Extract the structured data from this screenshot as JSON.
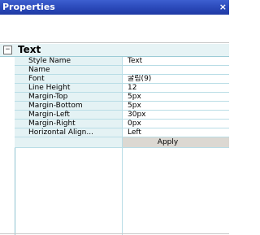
{
  "window": {
    "title": "Properties",
    "close_glyph": "×"
  },
  "section": {
    "label": "Text",
    "toggle": "−"
  },
  "properties": [
    {
      "name": "Style Name",
      "value": "Text"
    },
    {
      "name": "Name",
      "value": ""
    },
    {
      "name": "Font",
      "value": "굴림(9)"
    },
    {
      "name": "Line Height",
      "value": "12"
    },
    {
      "name": "Margin-Top",
      "value": "5px"
    },
    {
      "name": "Margin-Bottom",
      "value": "5px"
    },
    {
      "name": "Margin-Left",
      "value": "30px"
    },
    {
      "name": "Margin-Right",
      "value": "0px"
    },
    {
      "name": "Horizontal Align...",
      "value": "Left"
    }
  ],
  "apply_label": "Apply",
  "colors": {
    "titlebar": "#2a48b8",
    "name_cell": "#e4f2f4",
    "grid_line": "#b9dde6",
    "apply_button": "#dcd8d2"
  }
}
